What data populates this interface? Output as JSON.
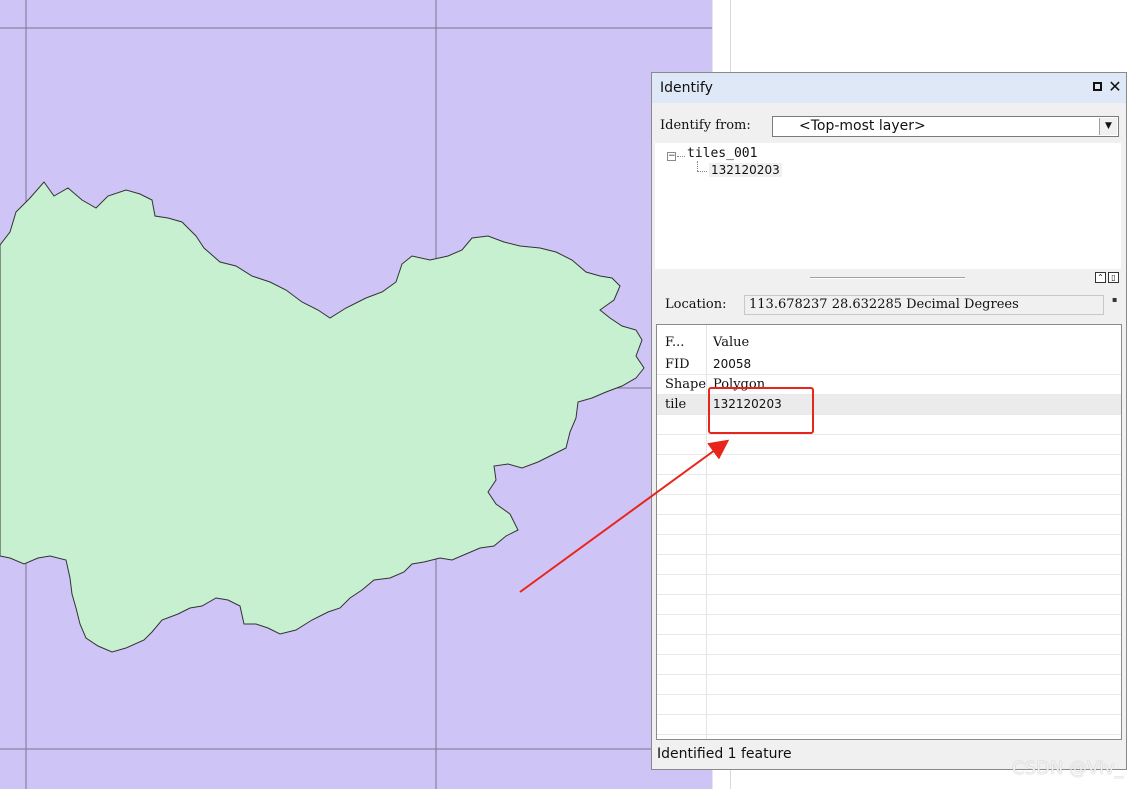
{
  "map": {
    "background": "#cfc4f6",
    "polygon_fill": "#c6f0d0",
    "polygon_stroke": "#333333"
  },
  "identify": {
    "title": "Identify",
    "identify_from_label": "Identify from:",
    "layer_select_value": "<Top-most layer>",
    "tree": {
      "layer": "tiles_001",
      "feature": "132120203"
    },
    "location_label": "Location:",
    "location_value": "113.678237  28.632285 Decimal Degrees",
    "table": {
      "header_field": "F...",
      "header_value": "Value",
      "rows": [
        {
          "field": "FID",
          "value": "20058"
        },
        {
          "field": "Shape",
          "value": "Polygon"
        },
        {
          "field": "tile",
          "value": "132120203"
        }
      ]
    },
    "status": "Identified 1 feature"
  },
  "annotation": {
    "color": "#e8251a"
  },
  "watermark": "CSDN @Viv_"
}
